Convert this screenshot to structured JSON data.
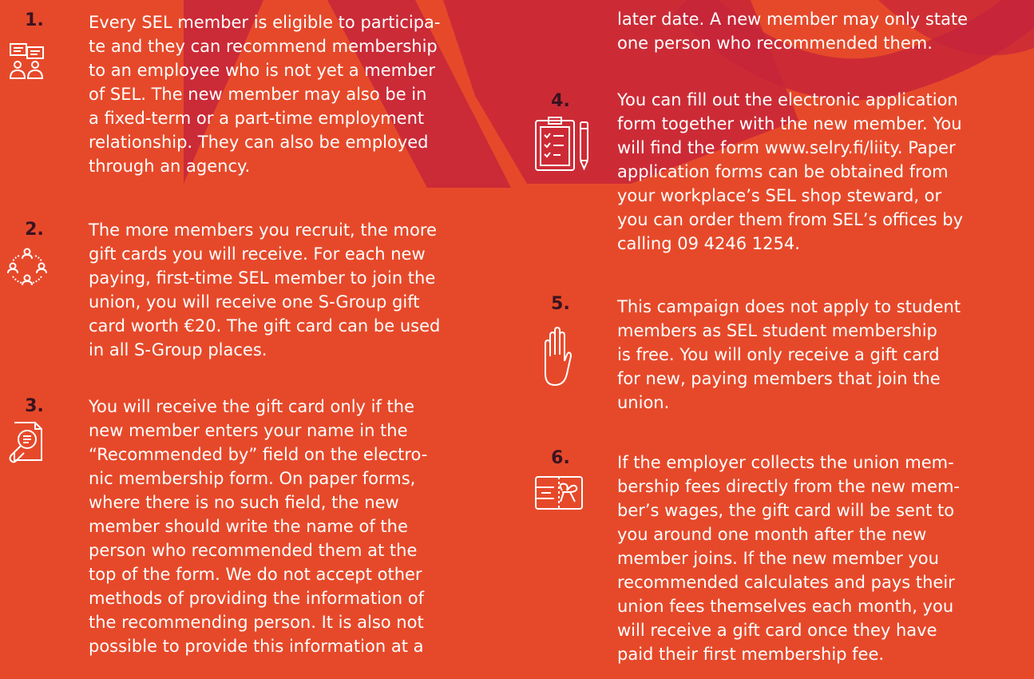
{
  "colors": {
    "background": "#e6492a",
    "decoration": "#c5243a",
    "number": "#3a1320",
    "text": "#ffffff"
  },
  "items": [
    {
      "number": "1.",
      "icon": "chat-people-icon",
      "lines": [
        "Every SEL member is eligible to participa-",
        "te and they can recommend membership",
        "to an employee who is not yet a member",
        "of SEL. The new member may also be in",
        "a fixed-term or a part-time employment",
        "relationship. They can also be employed",
        "through an agency."
      ]
    },
    {
      "number": "2.",
      "icon": "people-network-icon",
      "lines": [
        "The more members you recruit, the more",
        "gift cards you will receive. For each new",
        "paying, first-time SEL member to join the",
        "union, you will receive one S-Group gift",
        "card worth €20. The gift card can be used",
        "in all S-Group places."
      ]
    },
    {
      "number": "3.",
      "icon": "document-magnifier-icon",
      "lines": [
        "You will receive the gift card only if the",
        "new member enters your name in the",
        "“Recommended by” field on the electro-",
        "nic membership form. On paper forms,",
        "where there is no such field, the new",
        "member should write the name of the",
        "person who recommended them at the",
        "top of the form. We do not accept other",
        "methods of providing the information of",
        "the recommending person. It is also not",
        "possible to provide this information at a"
      ]
    },
    {
      "number": "",
      "icon": "",
      "lines": [
        "later date. A new member may only state",
        "one person who recommended them."
      ]
    },
    {
      "number": "4.",
      "icon": "clipboard-pencil-icon",
      "lines": [
        "You can fill out the electronic application",
        "form together with the new member. You",
        "will find the form www.selry.fi/liity. Paper",
        "application forms can be obtained from",
        "your workplace’s SEL shop steward, or",
        "you can order them from SEL’s offices by",
        "calling 09 4246 1254."
      ]
    },
    {
      "number": "5.",
      "icon": "raised-hand-icon",
      "lines": [
        "This campaign does not apply to student",
        "members as SEL student membership",
        "is free. You will only receive a gift card",
        "for new, paying members that join the",
        "union."
      ]
    },
    {
      "number": "6.",
      "icon": "gift-card-icon",
      "lines": [
        "If the employer collects the union mem-",
        "bership fees directly from the new mem-",
        "ber’s wages, the gift card will be sent to",
        "you around one month after the new",
        "member joins. If the new member you",
        "recommended calculates and pays their",
        "union fees themselves each month, you",
        "will receive a gift card once they have",
        "paid their first membership fee."
      ]
    }
  ]
}
